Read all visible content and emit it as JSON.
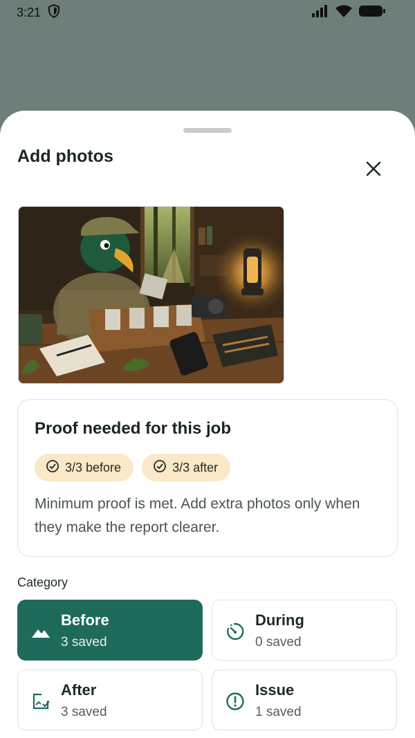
{
  "status_bar": {
    "time": "3:21"
  },
  "sheet": {
    "title": "Add photos"
  },
  "proof": {
    "title": "Proof needed for this job",
    "chips": [
      "3/3 before",
      "3/3 after"
    ],
    "body": "Minimum proof is met. Add extra photos only when they make the report clearer."
  },
  "category": {
    "label": "Category",
    "tiles": [
      {
        "name": "Before",
        "count": "3 saved",
        "icon": "landscape-icon",
        "selected": true
      },
      {
        "name": "During",
        "count": "0 saved",
        "icon": "timer-icon",
        "selected": false
      },
      {
        "name": "After",
        "count": "3 saved",
        "icon": "image-check-icon",
        "selected": false
      },
      {
        "name": "Issue",
        "count": "1 saved",
        "icon": "alert-circle-icon",
        "selected": false
      }
    ]
  },
  "colors": {
    "accent": "#1e6b5c",
    "chip_bg": "#fae8c8",
    "scrim": "#6e7e7a"
  }
}
